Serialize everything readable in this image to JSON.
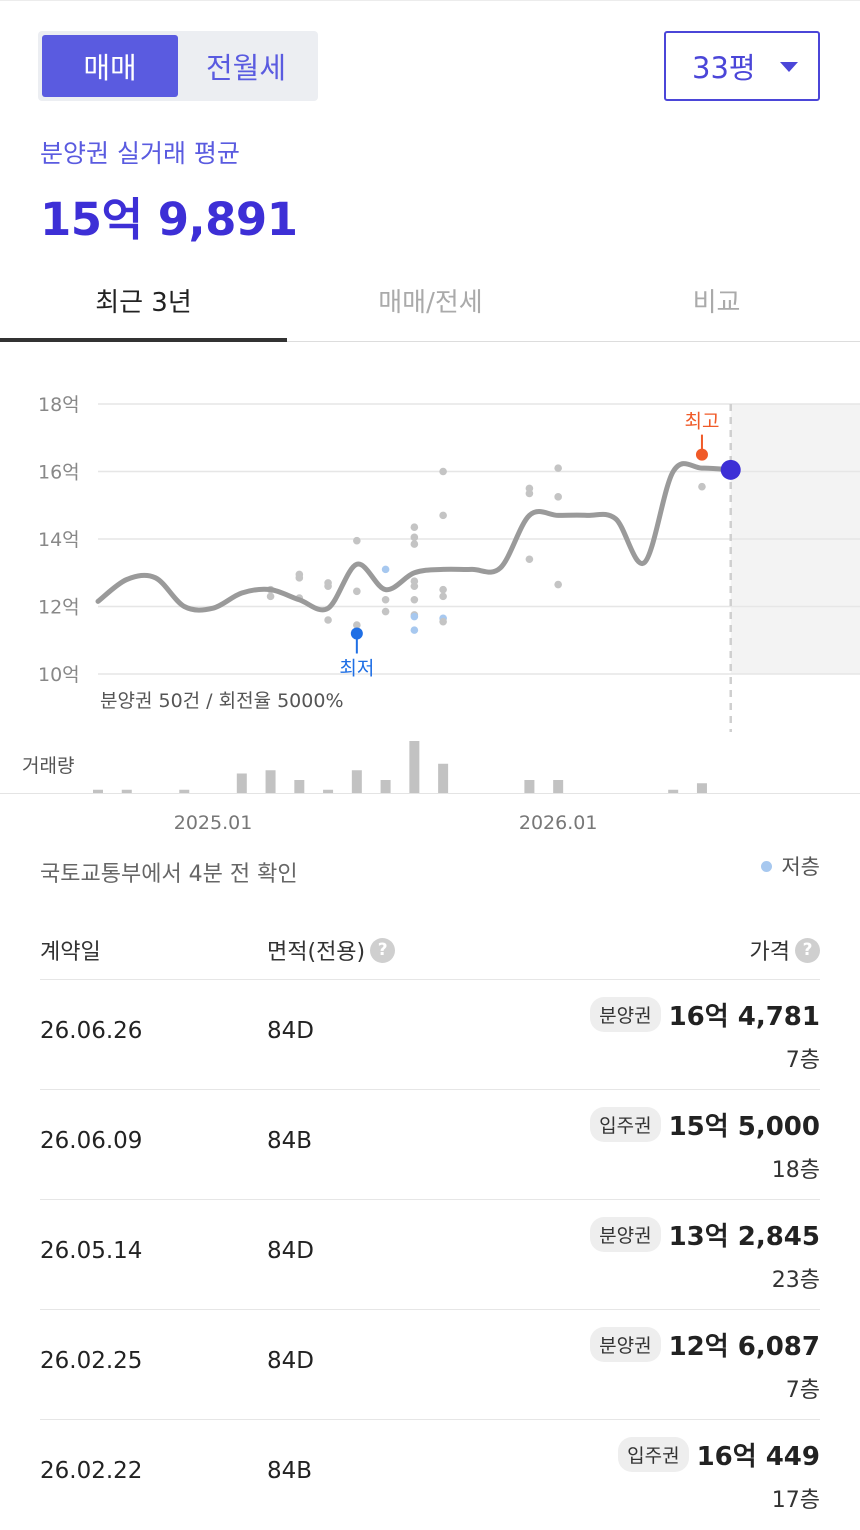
{
  "toggle": {
    "sale": "매매",
    "rent": "전월세"
  },
  "size_select": {
    "value": "33평"
  },
  "summary": {
    "label": "분양권 실거래 평균",
    "price": "15억 9,891"
  },
  "tabs": [
    {
      "label": "최근 3년"
    },
    {
      "label": "매매/전세"
    },
    {
      "label": "비교"
    }
  ],
  "chart_data": {
    "type": "scatter",
    "y_unit": "억",
    "ylim": [
      10,
      18
    ],
    "y_ticks": [
      {
        "value": 18,
        "label": "18억"
      },
      {
        "value": 16,
        "label": "16억"
      },
      {
        "value": 14,
        "label": "14억"
      },
      {
        "value": 12,
        "label": "12억"
      },
      {
        "value": 10,
        "label": "10억"
      }
    ],
    "xlim": [
      "2024-09",
      "2026-10"
    ],
    "x_ticks": [
      {
        "value": "2025-01",
        "label": "2025.01"
      },
      {
        "value": "2026-01",
        "label": "2026.01"
      }
    ],
    "grid": true,
    "note": "분양권 50건 / 회전율 5000%",
    "volume_label": "거래량",
    "markers": {
      "max": {
        "label": "최고",
        "x": "2026-06",
        "y": 16.5,
        "color": "#f05a28"
      },
      "min": {
        "label": "최저",
        "x": "2025-06",
        "y": 11.2,
        "color": "#1f6fe5"
      },
      "current": {
        "x": "2026-07",
        "y": 16.05,
        "color": "#3d2fd6"
      }
    },
    "trend": {
      "x": [
        "2024-09",
        "2024-10",
        "2024-11",
        "2024-12",
        "2025-01",
        "2025-02",
        "2025-03",
        "2025-04",
        "2025-05",
        "2025-06",
        "2025-07",
        "2025-08",
        "2025-09",
        "2025-10",
        "2025-11",
        "2025-12",
        "2026-01",
        "2026-02",
        "2026-03",
        "2026-04",
        "2026-05",
        "2026-06",
        "2026-07"
      ],
      "y": [
        12.15,
        12.8,
        12.85,
        12.0,
        11.95,
        12.4,
        12.5,
        12.2,
        11.95,
        13.25,
        12.5,
        13.0,
        13.1,
        13.1,
        13.15,
        14.7,
        14.7,
        14.7,
        14.6,
        13.3,
        16.0,
        16.1,
        16.05
      ]
    },
    "points": [
      {
        "x": "2025-03",
        "y": 12.5
      },
      {
        "x": "2025-03",
        "y": 12.3
      },
      {
        "x": "2025-04",
        "y": 12.95
      },
      {
        "x": "2025-04",
        "y": 12.85
      },
      {
        "x": "2025-04",
        "y": 12.25
      },
      {
        "x": "2025-05",
        "y": 12.7
      },
      {
        "x": "2025-05",
        "y": 12.6
      },
      {
        "x": "2025-05",
        "y": 11.6
      },
      {
        "x": "2025-06",
        "y": 13.95
      },
      {
        "x": "2025-06",
        "y": 12.45
      },
      {
        "x": "2025-06",
        "y": 11.45
      },
      {
        "x": "2025-07",
        "y": 13.1,
        "low_floor": true
      },
      {
        "x": "2025-07",
        "y": 12.2
      },
      {
        "x": "2025-07",
        "y": 11.85
      },
      {
        "x": "2025-08",
        "y": 14.35
      },
      {
        "x": "2025-08",
        "y": 14.05
      },
      {
        "x": "2025-08",
        "y": 13.85
      },
      {
        "x": "2025-08",
        "y": 12.75
      },
      {
        "x": "2025-08",
        "y": 12.6
      },
      {
        "x": "2025-08",
        "y": 12.2
      },
      {
        "x": "2025-08",
        "y": 11.75
      },
      {
        "x": "2025-08",
        "y": 11.7,
        "low_floor": true
      },
      {
        "x": "2025-08",
        "y": 11.3,
        "low_floor": true
      },
      {
        "x": "2025-09",
        "y": 16.0
      },
      {
        "x": "2025-09",
        "y": 14.7
      },
      {
        "x": "2025-09",
        "y": 12.5
      },
      {
        "x": "2025-09",
        "y": 12.3
      },
      {
        "x": "2025-09",
        "y": 11.65,
        "low_floor": true
      },
      {
        "x": "2025-09",
        "y": 11.55
      },
      {
        "x": "2025-12",
        "y": 15.5
      },
      {
        "x": "2025-12",
        "y": 15.35
      },
      {
        "x": "2025-12",
        "y": 13.4
      },
      {
        "x": "2026-01",
        "y": 16.1
      },
      {
        "x": "2026-01",
        "y": 15.25
      },
      {
        "x": "2026-01",
        "y": 12.65
      },
      {
        "x": "2026-06",
        "y": 15.55
      }
    ],
    "volume": [
      {
        "x": "2024-09",
        "value": 1
      },
      {
        "x": "2024-10",
        "value": 1
      },
      {
        "x": "2024-12",
        "value": 1
      },
      {
        "x": "2025-02",
        "value": 6
      },
      {
        "x": "2025-03",
        "value": 7
      },
      {
        "x": "2025-04",
        "value": 4
      },
      {
        "x": "2025-05",
        "value": 1
      },
      {
        "x": "2025-06",
        "value": 7
      },
      {
        "x": "2025-07",
        "value": 4
      },
      {
        "x": "2025-08",
        "value": 16
      },
      {
        "x": "2025-09",
        "value": 9
      },
      {
        "x": "2025-12",
        "value": 4
      },
      {
        "x": "2026-01",
        "value": 4
      },
      {
        "x": "2026-05",
        "value": 1
      },
      {
        "x": "2026-06",
        "value": 3
      }
    ],
    "colors": {
      "trend": "#9a9a9a",
      "point": "#c4c4c4",
      "low_floor_point": "#a7c8ef",
      "bar": "#c2c2c2",
      "future_band": "#f3f3f3"
    }
  },
  "source_note": "국토교통부에서 4분 전 확인",
  "legend": {
    "low_floor": "저층"
  },
  "table": {
    "headers": {
      "date": "계약일",
      "area": "면적(전용)",
      "price": "가격"
    },
    "rows": [
      {
        "date": "26.06.26",
        "area": "84D",
        "tag": "분양권",
        "price": "16억 4,781",
        "floor": "7층"
      },
      {
        "date": "26.06.09",
        "area": "84B",
        "tag": "입주권",
        "price": "15억 5,000",
        "floor": "18층"
      },
      {
        "date": "26.05.14",
        "area": "84D",
        "tag": "분양권",
        "price": "13억 2,845",
        "floor": "23층"
      },
      {
        "date": "26.02.25",
        "area": "84D",
        "tag": "분양권",
        "price": "12억 6,087",
        "floor": "7층"
      },
      {
        "date": "26.02.22",
        "area": "84B",
        "tag": "입주권",
        "price": "16억 449",
        "floor": "17층"
      }
    ]
  }
}
